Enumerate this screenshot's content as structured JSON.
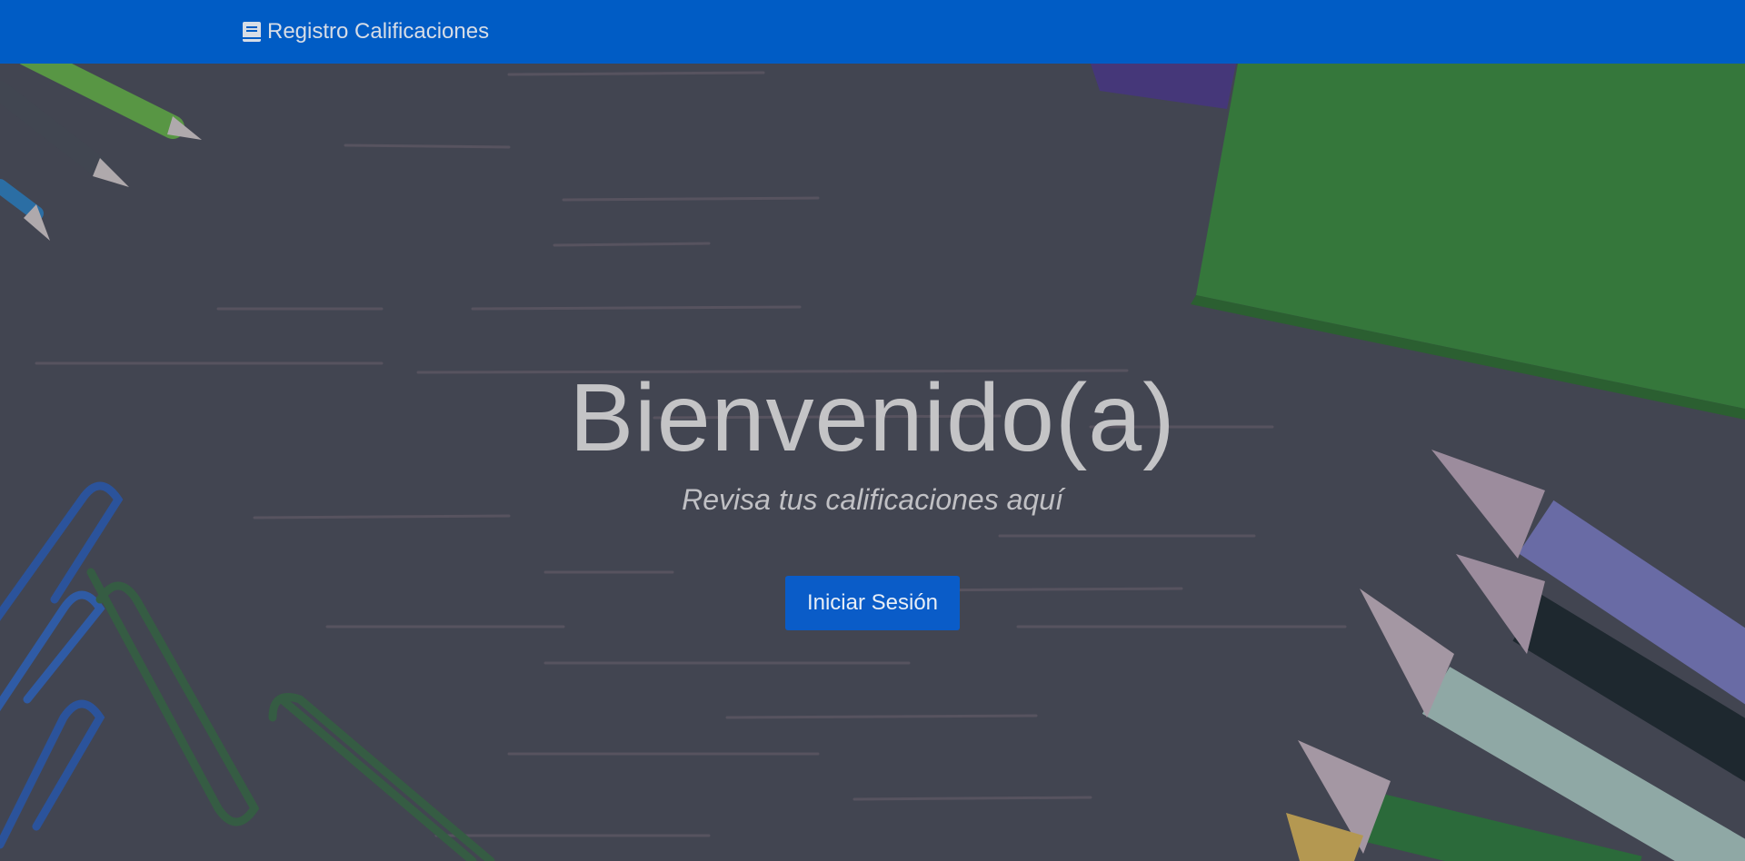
{
  "navbar": {
    "brand_label": "Registro Calificaciones",
    "brand_icon": "book-icon",
    "background": "#005cc5"
  },
  "hero": {
    "title": "Bienvenido(a)",
    "subtitle": "Revisa tus calificaciones aquí",
    "cta_label": "Iniciar Sesión",
    "cta_color": "#0a5cc8"
  }
}
